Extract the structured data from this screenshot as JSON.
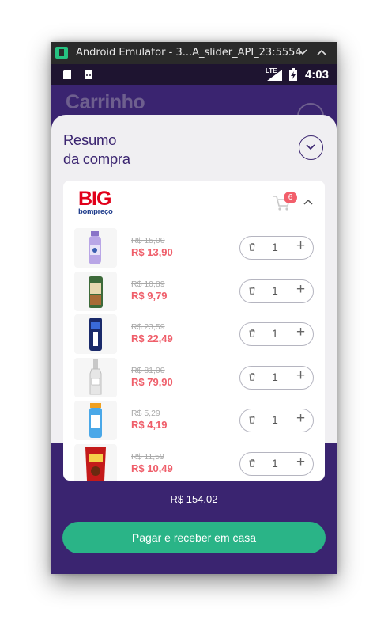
{
  "window": {
    "title": "Android Emulator - 3...A_slider_API_23:5554",
    "icons": [
      "emulator-icon",
      "chevron-down-icon",
      "chevron-up-icon"
    ]
  },
  "statusbar": {
    "time": "4:03",
    "network": "LTE"
  },
  "background": {
    "title": "Carrinho"
  },
  "summary": {
    "title_line1": "Resumo",
    "title_line2": "da compra"
  },
  "store": {
    "logo_text": "BIG",
    "logo_sub": "bompreço",
    "cart_count": "6"
  },
  "items": [
    {
      "old_price": "R$ 15,00",
      "new_price": "R$ 13,90",
      "qty": "1"
    },
    {
      "old_price": "R$ 10,89",
      "new_price": "R$ 9,79",
      "qty": "1"
    },
    {
      "old_price": "R$ 23,59",
      "new_price": "R$ 22,49",
      "qty": "1"
    },
    {
      "old_price": "R$ 81,00",
      "new_price": "R$ 79,90",
      "qty": "1"
    },
    {
      "old_price": "R$ 5,29",
      "new_price": "R$ 4,19",
      "qty": "1"
    },
    {
      "old_price": "R$ 11,59",
      "new_price": "R$ 10,49",
      "qty": "1"
    }
  ],
  "total": "R$ 154,02",
  "pay_button": "Pagar e receber em casa",
  "colors": {
    "primary": "#3a2470",
    "accent_green": "#2ab487",
    "price_red": "#ef5e6a",
    "badge": "#f25f6b"
  }
}
